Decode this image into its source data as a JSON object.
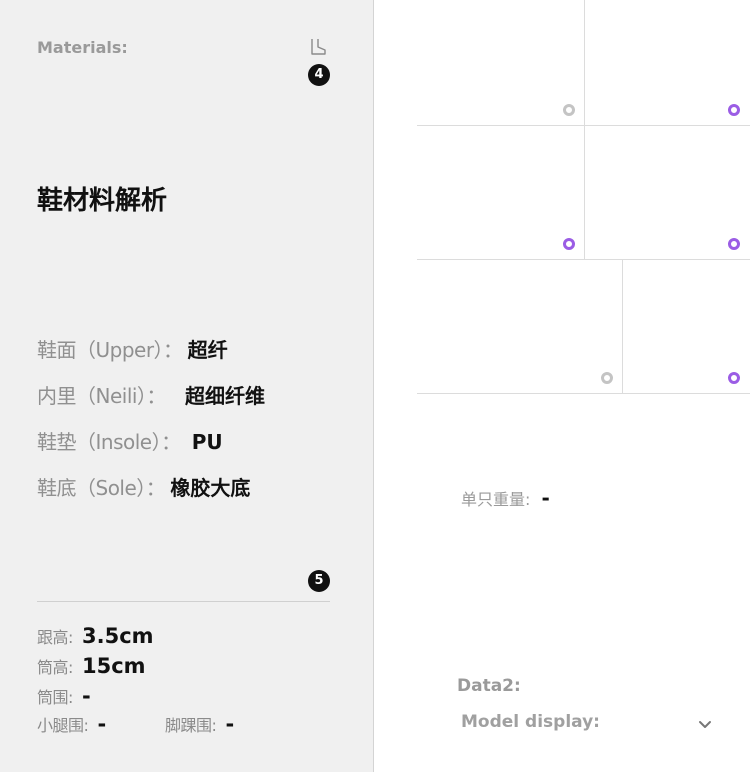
{
  "left_panel": {
    "materials_label": "Materials:",
    "badge_top": "4",
    "badge_bottom": "5",
    "title": "鞋材料解析",
    "materials": [
      {
        "key": "鞋面（Upper）：",
        "value": "超纤"
      },
      {
        "key": "内里（Neili）：",
        "value": "超细纤维"
      },
      {
        "key": "鞋垫（Insole）：",
        "value": "PU"
      },
      {
        "key": "鞋底（Sole）：",
        "value": "橡胶大底"
      }
    ],
    "specs": {
      "heel_height": {
        "key": "跟高:",
        "value": "3.5cm"
      },
      "shaft_height": {
        "key": "筒高:",
        "value": "15cm"
      },
      "shaft_circ": {
        "key": "筒围:",
        "value": "-"
      },
      "calf_circ": {
        "key": "小腿围:",
        "value": "-"
      },
      "ankle_circ": {
        "key": "脚踝围:",
        "value": "-"
      }
    }
  },
  "right_panel": {
    "weight": {
      "key": "单只重量:",
      "value": "-"
    },
    "data2_label": "Data2:",
    "model_display": {
      "label": "Model display:"
    }
  },
  "colors": {
    "accent_purple": "#9b5de5",
    "inactive_gray": "#c4c4c4",
    "panel_bg": "#f0f0f0"
  },
  "icons": {
    "boot": "boot-icon",
    "chevron": "chevron-down-icon",
    "selected_dot": "radio-dot-icon"
  }
}
